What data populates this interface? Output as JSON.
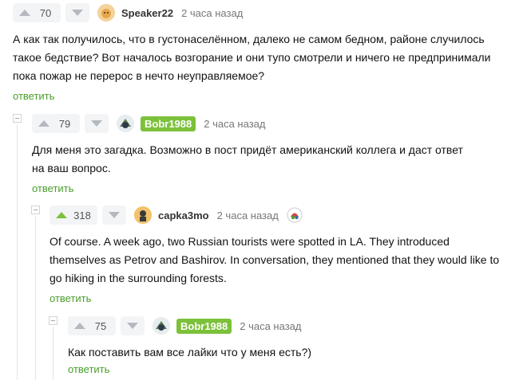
{
  "comments": [
    {
      "rating": "70",
      "author": "Speaker22",
      "time": "2 часа назад",
      "text": "А как так получилось, что в густонаселённом, далеко не самом бедном, районе случилось такое бедствие? Вот началось возгорание и они тупо смотрели и ничего не предпринимали пока пожар не перерос в нечто неуправляемое?",
      "reply": "ответить"
    },
    {
      "rating": "79",
      "author": "Bobr1988",
      "time": "2 часа назад",
      "text": "Для меня это загадка. Возможно в пост придёт американский коллега и даст ответ на ваш вопрос.",
      "reply": "ответить"
    },
    {
      "rating": "318",
      "author": "capka3mo",
      "time": "2 часа назад",
      "text": "Of course. A week ago, two Russian tourists were spotted in LA. They introduced themselves as Petrov and Bashirov. In conversation, they mentioned that they would like to go hiking in the surrounding forests.",
      "reply": "ответить"
    },
    {
      "rating": "75",
      "author": "Bobr1988",
      "time": "2 часа назад",
      "text": "Как поставить вам все лайки что у меня есть?)",
      "reply": "ответить"
    }
  ],
  "colors": {
    "accent": "#7cc13a",
    "link": "#4a9e2a"
  }
}
